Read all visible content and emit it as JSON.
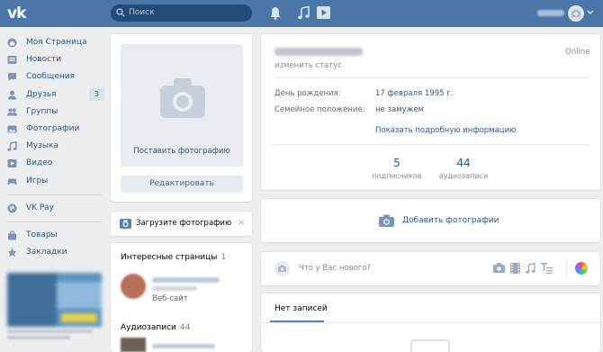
{
  "header": {
    "logo_text": "vk",
    "search_placeholder": "Поиск",
    "icons": [
      "bell-icon",
      "music-icon",
      "play-icon"
    ]
  },
  "nav": {
    "items": [
      {
        "label": "Моя Страница",
        "icon": "home-icon"
      },
      {
        "label": "Новости",
        "icon": "news-icon"
      },
      {
        "label": "Сообщения",
        "icon": "messages-icon"
      },
      {
        "label": "Друзья",
        "icon": "friends-icon",
        "badge": "3"
      },
      {
        "label": "Группы",
        "icon": "groups-icon"
      },
      {
        "label": "Фотографии",
        "icon": "photos-icon"
      },
      {
        "label": "Музыка",
        "icon": "music-icon"
      },
      {
        "label": "Видео",
        "icon": "video-icon"
      },
      {
        "label": "Игры",
        "icon": "games-icon"
      }
    ],
    "vkpay": "VK Pay",
    "goods": "Товары",
    "bookmarks": "Закладки"
  },
  "photo_card": {
    "upload_link": "Поставить фотографию",
    "edit_button": "Редактировать"
  },
  "upload_prompt": {
    "text": "Загрузите фотографию",
    "close": "×"
  },
  "pages": {
    "title": "Интересные страницы",
    "count": "1",
    "item_subtitle": "Веб-сайт",
    "audio_title": "Аудиозаписи",
    "audio_count": "44"
  },
  "profile": {
    "status": "изменить статус",
    "online": "Online",
    "birthday_label": "День рождения:",
    "birthday_value": "17 февраля 1995 г.",
    "marital_label": "Семейное положение:",
    "marital_value": "не замужем",
    "more_info": "Показать подробную информацию",
    "stats": [
      {
        "value": "5",
        "label": "подписчиков"
      },
      {
        "value": "44",
        "label": "аудиозаписи"
      }
    ]
  },
  "add_photos": {
    "label": "Добавить фотографии"
  },
  "post": {
    "placeholder": "Что у Вас нового?"
  },
  "wall": {
    "tab": "Нет записей"
  },
  "colors": {
    "header_bg": "#4a76a8",
    "link": "#2a5885",
    "page_bg": "#edeef0"
  }
}
